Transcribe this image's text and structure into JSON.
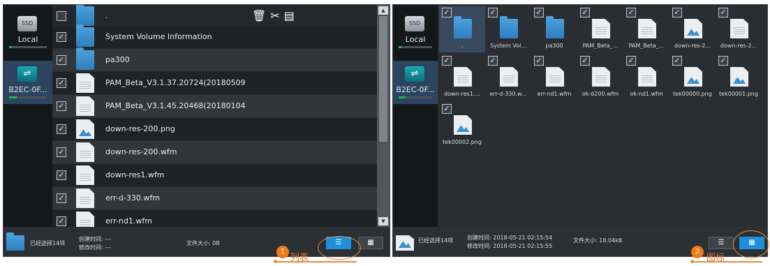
{
  "left_panel": {
    "drives": [
      {
        "icon": "ssd-drive-icon",
        "badge": "SSD",
        "label": "Local"
      },
      {
        "icon": "usb-drive-icon",
        "badge": "⇌",
        "label": "B2EC-0F..."
      }
    ],
    "rows": [
      {
        "name": ".",
        "type": "folder",
        "checked": false
      },
      {
        "name": "System Volume Information",
        "type": "folder",
        "checked": true
      },
      {
        "name": "pa300",
        "type": "folder",
        "checked": true
      },
      {
        "name": "PAM_Beta_V3.1.37.20724(20180509",
        "type": "doc",
        "checked": true
      },
      {
        "name": "PAM_Beta_V3.1.45.20468(20180104",
        "type": "doc",
        "checked": true
      },
      {
        "name": "down-res-200.png",
        "type": "img",
        "checked": true
      },
      {
        "name": "down-res-200.wfm",
        "type": "doc",
        "checked": true
      },
      {
        "name": "down-res1.wfm",
        "type": "doc",
        "checked": true
      },
      {
        "name": "err-d-330.wfm",
        "type": "doc",
        "checked": true
      },
      {
        "name": "err-nd1.wfm",
        "type": "doc",
        "checked": true
      }
    ],
    "toolbar_icons": {
      "delete": "🗑",
      "cut": "✂",
      "paste": "▤"
    },
    "status": {
      "selected": "已经选择14项",
      "created": "创建时间: ---",
      "modified": "修改时间: ---",
      "size": "文件大小: 0B"
    },
    "view_buttons": {
      "list_glyph": "☰",
      "icon_glyph": "▦",
      "active": "list"
    }
  },
  "right_panel": {
    "drives": [
      {
        "badge": "SSD",
        "label": "Local"
      },
      {
        "badge": "⇌",
        "label": "B2EC-0F..."
      }
    ],
    "tiles": [
      {
        "name": ".",
        "type": "folder",
        "checked": true
      },
      {
        "name": "System Vol...",
        "type": "folder",
        "checked": true
      },
      {
        "name": "pa300",
        "type": "folder",
        "checked": true
      },
      {
        "name": "PAM_Beta_...",
        "type": "doc",
        "checked": true
      },
      {
        "name": "PAM_Beta_...",
        "type": "doc",
        "checked": true
      },
      {
        "name": "down-res-2...",
        "type": "img",
        "checked": true
      },
      {
        "name": "down-res-2...",
        "type": "doc",
        "checked": true
      },
      {
        "name": "down-res1....",
        "type": "doc",
        "checked": true
      },
      {
        "name": "err-d-330.w...",
        "type": "doc",
        "checked": true
      },
      {
        "name": "err-nd1.wfm",
        "type": "doc",
        "checked": true
      },
      {
        "name": "ok-d200.wfm",
        "type": "doc",
        "checked": true
      },
      {
        "name": "ok-nd1.wfm",
        "type": "doc",
        "checked": true
      },
      {
        "name": "tek00000.png",
        "type": "img",
        "checked": true
      },
      {
        "name": "tek00001.png",
        "type": "img",
        "checked": true
      },
      {
        "name": "tek00002.png",
        "type": "img",
        "checked": true
      }
    ],
    "status": {
      "selected": "已经选择14项",
      "created": "创建时间: 2018-05-21 02:15:54",
      "modified": "修改时间: 2018-05-21 02:15:55",
      "size": "文件大小: 18.04kB"
    },
    "view_buttons": {
      "list_glyph": "☰",
      "icon_glyph": "▦",
      "active": "icon"
    }
  },
  "annotations": [
    {
      "number": "1",
      "label": "列表"
    },
    {
      "number": "2",
      "label": "图标"
    }
  ],
  "colors": {
    "accent": "#1f8fdc",
    "annotation": "#e58a3a",
    "panel_bg": "#1e2226"
  }
}
